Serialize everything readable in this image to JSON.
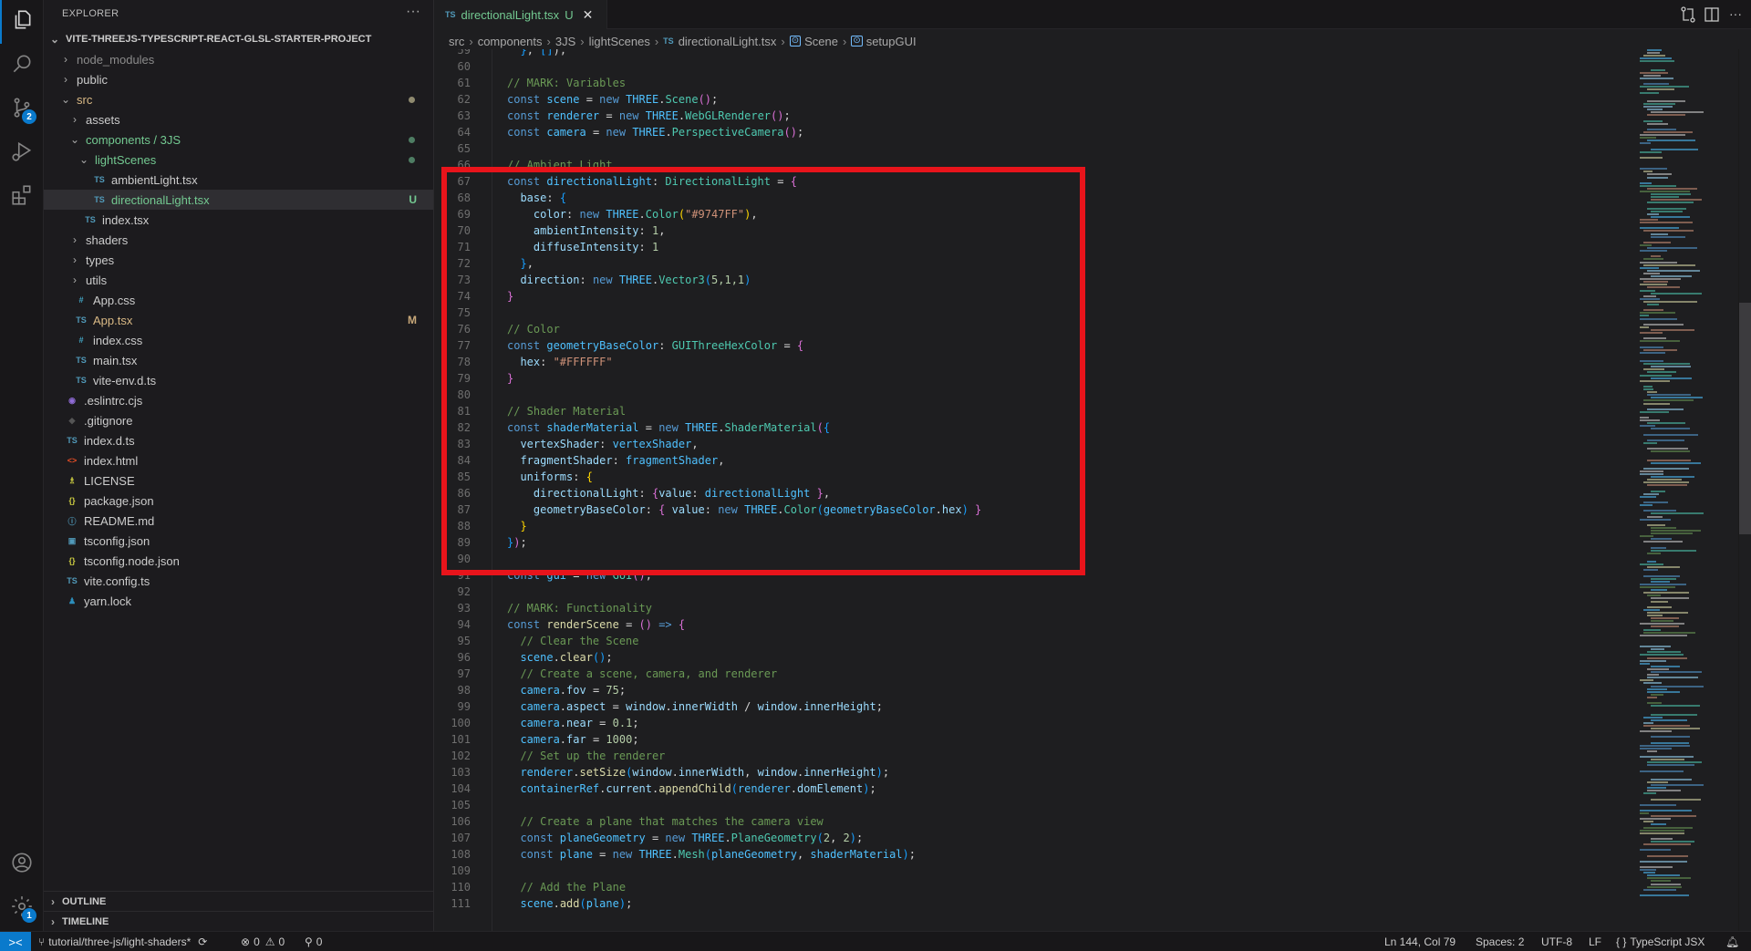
{
  "activity_bar": {
    "items": [
      {
        "name": "explorer",
        "active": true
      },
      {
        "name": "search",
        "active": false
      },
      {
        "name": "source-control",
        "active": false,
        "badge": "2"
      },
      {
        "name": "run-and-debug",
        "active": false
      },
      {
        "name": "extensions",
        "active": false
      }
    ],
    "bottom": [
      {
        "name": "accounts"
      },
      {
        "name": "manage",
        "badge": "1"
      }
    ]
  },
  "sidebar": {
    "title": "EXPLORER",
    "more": "···",
    "root": "VITE-THREEJS-TYPESCRIPT-REACT-GLSL-STARTER-PROJECT",
    "tree": [
      {
        "label": "node_modules",
        "depth": 1,
        "kind": "folder",
        "expanded": false,
        "color": "#8b8b8b"
      },
      {
        "label": "public",
        "depth": 1,
        "kind": "folder",
        "expanded": false
      },
      {
        "label": "src",
        "depth": 1,
        "kind": "folder",
        "expanded": true,
        "color": "#d9b985",
        "dot": "#8f8a6f"
      },
      {
        "label": "assets",
        "depth": 2,
        "kind": "folder",
        "expanded": false
      },
      {
        "label": "components / 3JS",
        "depth": 2,
        "kind": "folder",
        "expanded": true,
        "color": "#73c991",
        "dot": "#4e7d63"
      },
      {
        "label": "lightScenes",
        "depth": 3,
        "kind": "folder",
        "expanded": true,
        "color": "#73c991",
        "dot": "#4e7d63"
      },
      {
        "label": "ambientLight.tsx",
        "depth": 4,
        "kind": "ts"
      },
      {
        "label": "directionalLight.tsx",
        "depth": 4,
        "kind": "ts",
        "selected": true,
        "color": "#73c991",
        "status": "U",
        "status_color": "#73c991"
      },
      {
        "label": "index.tsx",
        "depth": 3,
        "kind": "ts"
      },
      {
        "label": "shaders",
        "depth": 2,
        "kind": "folder",
        "expanded": false
      },
      {
        "label": "types",
        "depth": 2,
        "kind": "folder",
        "expanded": false
      },
      {
        "label": "utils",
        "depth": 2,
        "kind": "folder",
        "expanded": false
      },
      {
        "label": "App.css",
        "depth": 2,
        "kind": "css"
      },
      {
        "label": "App.tsx",
        "depth": 2,
        "kind": "ts",
        "color": "#d9b985",
        "status": "M",
        "status_color": "#c9a97a"
      },
      {
        "label": "index.css",
        "depth": 2,
        "kind": "css"
      },
      {
        "label": "main.tsx",
        "depth": 2,
        "kind": "ts"
      },
      {
        "label": "vite-env.d.ts",
        "depth": 2,
        "kind": "ts"
      },
      {
        "label": ".eslintrc.cjs",
        "depth": 1,
        "kind": "eslint"
      },
      {
        "label": ".gitignore",
        "depth": 1,
        "kind": "git"
      },
      {
        "label": "index.d.ts",
        "depth": 1,
        "kind": "ts"
      },
      {
        "label": "index.html",
        "depth": 1,
        "kind": "html"
      },
      {
        "label": "LICENSE",
        "depth": 1,
        "kind": "license"
      },
      {
        "label": "package.json",
        "depth": 1,
        "kind": "json"
      },
      {
        "label": "README.md",
        "depth": 1,
        "kind": "info"
      },
      {
        "label": "tsconfig.json",
        "depth": 1,
        "kind": "tsconfig"
      },
      {
        "label": "tsconfig.node.json",
        "depth": 1,
        "kind": "json"
      },
      {
        "label": "vite.config.ts",
        "depth": 1,
        "kind": "ts"
      },
      {
        "label": "yarn.lock",
        "depth": 1,
        "kind": "yarn"
      }
    ],
    "panels": [
      "OUTLINE",
      "TIMELINE"
    ]
  },
  "tabs": [
    {
      "icon": "TS",
      "label": "directionalLight.tsx",
      "status": "U",
      "close": "✕",
      "active": true
    }
  ],
  "toolbar": [
    "open-changes",
    "split-editor",
    "more-actions"
  ],
  "breadcrumb": {
    "items": [
      "src",
      "components",
      "3JS",
      "lightScenes",
      "directionalLight.tsx",
      "Scene",
      "setupGUI"
    ],
    "file_icon": "TS"
  },
  "editor": {
    "first_line": 59,
    "highlight": {
      "from_line": 67,
      "to_line": 90,
      "color": "#e8141b"
    },
    "lines": [
      [
        [
          "p3",
          "  }"
        ],
        [
          "op",
          ", "
        ],
        [
          "p3",
          "[]"
        ],
        [
          "op",
          ");"
        ]
      ],
      [],
      [
        [
          "com",
          "// MARK: Variables"
        ]
      ],
      [
        [
          "kw",
          "const "
        ],
        [
          "var",
          "scene"
        ],
        [
          "op",
          " = "
        ],
        [
          "kw",
          "new "
        ],
        [
          "var",
          "THREE"
        ],
        [
          "op",
          "."
        ],
        [
          "type",
          "Scene"
        ],
        [
          "p1",
          "()"
        ],
        [
          "op",
          ";"
        ]
      ],
      [
        [
          "kw",
          "const "
        ],
        [
          "var",
          "renderer"
        ],
        [
          "op",
          " = "
        ],
        [
          "kw",
          "new "
        ],
        [
          "var",
          "THREE"
        ],
        [
          "op",
          "."
        ],
        [
          "type",
          "WebGLRenderer"
        ],
        [
          "p1",
          "()"
        ],
        [
          "op",
          ";"
        ]
      ],
      [
        [
          "kw",
          "const "
        ],
        [
          "var",
          "camera"
        ],
        [
          "op",
          " = "
        ],
        [
          "kw",
          "new "
        ],
        [
          "var",
          "THREE"
        ],
        [
          "op",
          "."
        ],
        [
          "type",
          "PerspectiveCamera"
        ],
        [
          "p1",
          "()"
        ],
        [
          "op",
          ";"
        ]
      ],
      [],
      [
        [
          "com",
          "// Ambient Light"
        ]
      ],
      [
        [
          "kw",
          "const "
        ],
        [
          "var",
          "directionalLight"
        ],
        [
          "op",
          ": "
        ],
        [
          "type",
          "DirectionalLight"
        ],
        [
          "op",
          " = "
        ],
        [
          "p1",
          "{"
        ]
      ],
      [
        [
          "prop",
          "  base"
        ],
        [
          "op",
          ": "
        ],
        [
          "p3",
          "{"
        ]
      ],
      [
        [
          "prop",
          "    color"
        ],
        [
          "op",
          ": "
        ],
        [
          "kw",
          "new "
        ],
        [
          "var",
          "THREE"
        ],
        [
          "op",
          "."
        ],
        [
          "type",
          "Color"
        ],
        [
          "p2",
          "("
        ],
        [
          "str",
          "\"#9747FF\""
        ],
        [
          "p2",
          ")"
        ],
        [
          "op",
          ","
        ]
      ],
      [
        [
          "prop",
          "    ambientIntensity"
        ],
        [
          "op",
          ": "
        ],
        [
          "num",
          "1"
        ],
        [
          "op",
          ","
        ]
      ],
      [
        [
          "prop",
          "    diffuseIntensity"
        ],
        [
          "op",
          ": "
        ],
        [
          "num",
          "1"
        ]
      ],
      [
        [
          "p3",
          "  }"
        ],
        [
          "op",
          ","
        ]
      ],
      [
        [
          "prop",
          "  direction"
        ],
        [
          "op",
          ": "
        ],
        [
          "kw",
          "new "
        ],
        [
          "var",
          "THREE"
        ],
        [
          "op",
          "."
        ],
        [
          "type",
          "Vector3"
        ],
        [
          "p3",
          "("
        ],
        [
          "num",
          "5,1,1"
        ],
        [
          "p3",
          ")"
        ]
      ],
      [
        [
          "p1",
          "}"
        ]
      ],
      [],
      [
        [
          "com",
          "// Color"
        ]
      ],
      [
        [
          "kw",
          "const "
        ],
        [
          "var",
          "geometryBaseColor"
        ],
        [
          "op",
          ": "
        ],
        [
          "type",
          "GUIThreeHexColor"
        ],
        [
          "op",
          " = "
        ],
        [
          "p1",
          "{"
        ]
      ],
      [
        [
          "prop",
          "  hex"
        ],
        [
          "op",
          ": "
        ],
        [
          "str",
          "\"#FFFFFF\""
        ]
      ],
      [
        [
          "p1",
          "}"
        ]
      ],
      [],
      [
        [
          "com",
          "// Shader Material"
        ]
      ],
      [
        [
          "kw",
          "const "
        ],
        [
          "var",
          "shaderMaterial"
        ],
        [
          "op",
          " = "
        ],
        [
          "kw",
          "new "
        ],
        [
          "var",
          "THREE"
        ],
        [
          "op",
          "."
        ],
        [
          "type",
          "ShaderMaterial"
        ],
        [
          "p1",
          "("
        ],
        [
          "p3",
          "{"
        ]
      ],
      [
        [
          "prop",
          "  vertexShader"
        ],
        [
          "op",
          ": "
        ],
        [
          "var",
          "vertexShader"
        ],
        [
          "op",
          ","
        ]
      ],
      [
        [
          "prop",
          "  fragmentShader"
        ],
        [
          "op",
          ": "
        ],
        [
          "var",
          "fragmentShader"
        ],
        [
          "op",
          ","
        ]
      ],
      [
        [
          "prop",
          "  uniforms"
        ],
        [
          "op",
          ": "
        ],
        [
          "p2",
          "{"
        ]
      ],
      [
        [
          "prop",
          "    directionalLight"
        ],
        [
          "op",
          ": "
        ],
        [
          "p1",
          "{"
        ],
        [
          "prop",
          "value"
        ],
        [
          "op",
          ": "
        ],
        [
          "var",
          "directionalLight "
        ],
        [
          "p1",
          "}"
        ],
        [
          "op",
          ","
        ]
      ],
      [
        [
          "prop",
          "    geometryBaseColor"
        ],
        [
          "op",
          ": "
        ],
        [
          "p1",
          "{ "
        ],
        [
          "prop",
          "value"
        ],
        [
          "op",
          ": "
        ],
        [
          "kw",
          "new "
        ],
        [
          "var",
          "THREE"
        ],
        [
          "op",
          "."
        ],
        [
          "type",
          "Color"
        ],
        [
          "p3",
          "("
        ],
        [
          "var",
          "geometryBaseColor"
        ],
        [
          "op",
          "."
        ],
        [
          "prop",
          "hex"
        ],
        [
          "p3",
          ")"
        ],
        [
          "p1",
          " }"
        ]
      ],
      [
        [
          "p2",
          "  }"
        ]
      ],
      [
        [
          "p3",
          "}"
        ],
        [
          "p1",
          ")"
        ],
        [
          "op",
          ";"
        ]
      ],
      [],
      [
        [
          "kw",
          "const "
        ],
        [
          "var",
          "gui"
        ],
        [
          "op",
          " = "
        ],
        [
          "kw",
          "new "
        ],
        [
          "type",
          "GUI"
        ],
        [
          "p1",
          "()"
        ],
        [
          "op",
          ";"
        ]
      ],
      [],
      [
        [
          "com",
          "// MARK: Functionality"
        ]
      ],
      [
        [
          "kw",
          "const "
        ],
        [
          "fn",
          "renderScene"
        ],
        [
          "op",
          " = "
        ],
        [
          "p1",
          "()"
        ],
        [
          "kw",
          " => "
        ],
        [
          "p1",
          "{"
        ]
      ],
      [
        [
          "com",
          "  // Clear the Scene"
        ]
      ],
      [
        [
          "var",
          "  scene"
        ],
        [
          "op",
          "."
        ],
        [
          "fn",
          "clear"
        ],
        [
          "p3",
          "()"
        ],
        [
          "op",
          ";"
        ]
      ],
      [
        [
          "com",
          "  // Create a scene, camera, and renderer"
        ]
      ],
      [
        [
          "var",
          "  camera"
        ],
        [
          "op",
          "."
        ],
        [
          "prop",
          "fov"
        ],
        [
          "op",
          " = "
        ],
        [
          "num",
          "75"
        ],
        [
          "op",
          ";"
        ]
      ],
      [
        [
          "var",
          "  camera"
        ],
        [
          "op",
          "."
        ],
        [
          "prop",
          "aspect"
        ],
        [
          "op",
          " = "
        ],
        [
          "prop",
          "window"
        ],
        [
          "op",
          "."
        ],
        [
          "prop",
          "innerWidth"
        ],
        [
          "op",
          " / "
        ],
        [
          "prop",
          "window"
        ],
        [
          "op",
          "."
        ],
        [
          "prop",
          "innerHeight"
        ],
        [
          "op",
          ";"
        ]
      ],
      [
        [
          "var",
          "  camera"
        ],
        [
          "op",
          "."
        ],
        [
          "prop",
          "near"
        ],
        [
          "op",
          " = "
        ],
        [
          "num",
          "0.1"
        ],
        [
          "op",
          ";"
        ]
      ],
      [
        [
          "var",
          "  camera"
        ],
        [
          "op",
          "."
        ],
        [
          "prop",
          "far"
        ],
        [
          "op",
          " = "
        ],
        [
          "num",
          "1000"
        ],
        [
          "op",
          ";"
        ]
      ],
      [
        [
          "com",
          "  // Set up the renderer"
        ]
      ],
      [
        [
          "var",
          "  renderer"
        ],
        [
          "op",
          "."
        ],
        [
          "fn",
          "setSize"
        ],
        [
          "p3",
          "("
        ],
        [
          "prop",
          "window"
        ],
        [
          "op",
          "."
        ],
        [
          "prop",
          "innerWidth"
        ],
        [
          "op",
          ", "
        ],
        [
          "prop",
          "window"
        ],
        [
          "op",
          "."
        ],
        [
          "prop",
          "innerHeight"
        ],
        [
          "p3",
          ")"
        ],
        [
          "op",
          ";"
        ]
      ],
      [
        [
          "var",
          "  containerRef"
        ],
        [
          "op",
          "."
        ],
        [
          "prop",
          "current"
        ],
        [
          "op",
          "."
        ],
        [
          "fn",
          "appendChild"
        ],
        [
          "p3",
          "("
        ],
        [
          "var",
          "renderer"
        ],
        [
          "op",
          "."
        ],
        [
          "prop",
          "domElement"
        ],
        [
          "p3",
          ")"
        ],
        [
          "op",
          ";"
        ]
      ],
      [],
      [
        [
          "com",
          "  // Create a plane that matches the camera view"
        ]
      ],
      [
        [
          "kw",
          "  const "
        ],
        [
          "var",
          "planeGeometry"
        ],
        [
          "op",
          " = "
        ],
        [
          "kw",
          "new "
        ],
        [
          "var",
          "THREE"
        ],
        [
          "op",
          "."
        ],
        [
          "type",
          "PlaneGeometry"
        ],
        [
          "p3",
          "("
        ],
        [
          "num",
          "2"
        ],
        [
          "op",
          ", "
        ],
        [
          "num",
          "2"
        ],
        [
          "p3",
          ")"
        ],
        [
          "op",
          ";"
        ]
      ],
      [
        [
          "kw",
          "  const "
        ],
        [
          "var",
          "plane"
        ],
        [
          "op",
          " = "
        ],
        [
          "kw",
          "new "
        ],
        [
          "var",
          "THREE"
        ],
        [
          "op",
          "."
        ],
        [
          "type",
          "Mesh"
        ],
        [
          "p3",
          "("
        ],
        [
          "var",
          "planeGeometry"
        ],
        [
          "op",
          ", "
        ],
        [
          "var",
          "shaderMaterial"
        ],
        [
          "p3",
          ")"
        ],
        [
          "op",
          ";"
        ]
      ],
      [],
      [
        [
          "com",
          "  // Add the Plane"
        ]
      ],
      [
        [
          "var",
          "  scene"
        ],
        [
          "op",
          "."
        ],
        [
          "fn",
          "add"
        ],
        [
          "p3",
          "("
        ],
        [
          "var",
          "plane"
        ],
        [
          "p3",
          ")"
        ],
        [
          "op",
          ";"
        ]
      ]
    ]
  },
  "statusbar": {
    "remote_icon": "><",
    "branch": "tutorial/three-js/light-shaders*",
    "sync_icon": "⟳",
    "errors": "0",
    "warnings": "0",
    "ports": "0",
    "cursor": "Ln 144, Col 79",
    "indent": "Spaces: 2",
    "encoding": "UTF-8",
    "eol": "LF",
    "language_icon": "{ }",
    "language": "TypeScript JSX",
    "notifications_icon": "bell"
  }
}
